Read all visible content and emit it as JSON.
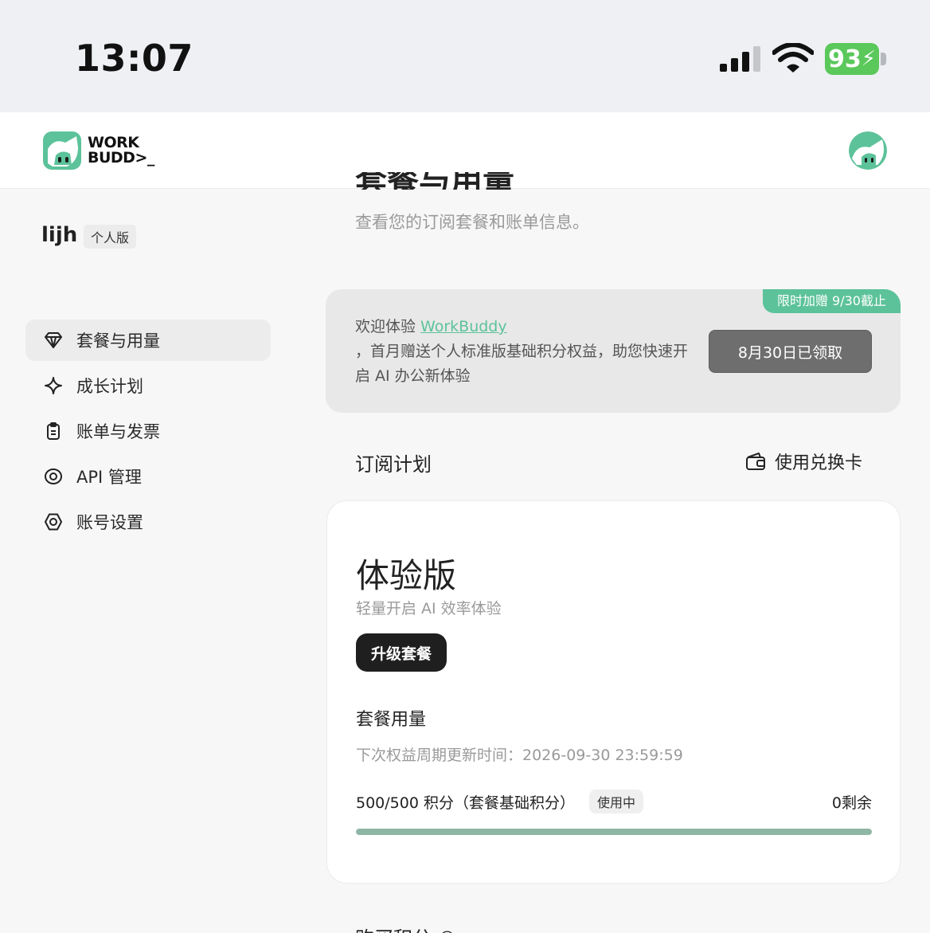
{
  "status_bar": {
    "time": "13:07",
    "battery": "93"
  },
  "header": {
    "logo_line1": "WORK",
    "logo_line2": "BUDD>_"
  },
  "sidebar": {
    "username": "lijh",
    "plan_badge": "个人版",
    "items": [
      {
        "label": "套餐与用量",
        "icon": "diamond-icon",
        "active": true
      },
      {
        "label": "成长计划",
        "icon": "sparkle-icon",
        "active": false
      },
      {
        "label": "账单与发票",
        "icon": "clipboard-icon",
        "active": false
      },
      {
        "label": "API 管理",
        "icon": "eye-icon",
        "active": false
      },
      {
        "label": "账号设置",
        "icon": "settings-hex-icon",
        "active": false
      }
    ]
  },
  "main": {
    "title": "套餐与用量",
    "subtitle": "查看您的订阅套餐和账单信息。",
    "welcome": {
      "promo_tag": "限时加赠 9/30截止",
      "prefix": "欢迎体验 ",
      "link": "WorkBuddy",
      "body": "，首月赠送个人标准版基础积分权益，助您快速开启 AI 办公新体验",
      "claim_button": "8月30日已领取"
    },
    "subscription_title": "订阅计划",
    "redeem_label": "使用兑换卡",
    "plan": {
      "name": "体验版",
      "description": "轻量开启 AI 效率体验",
      "upgrade_button": "升级套餐",
      "usage_title": "套餐用量",
      "refresh_time": "下次权益周期更新时间：2026-09-30 23:59:59",
      "usage_text": "500/500 积分（套餐基础积分）",
      "usage_status": "使用中",
      "remaining": "0剩余",
      "progress_fraction": 1.0
    },
    "next_section_partial": "购买积分 ©"
  },
  "colors": {
    "accent": "#5cc29a",
    "progress": "#8fb5a4",
    "battery": "#5ac85a"
  }
}
